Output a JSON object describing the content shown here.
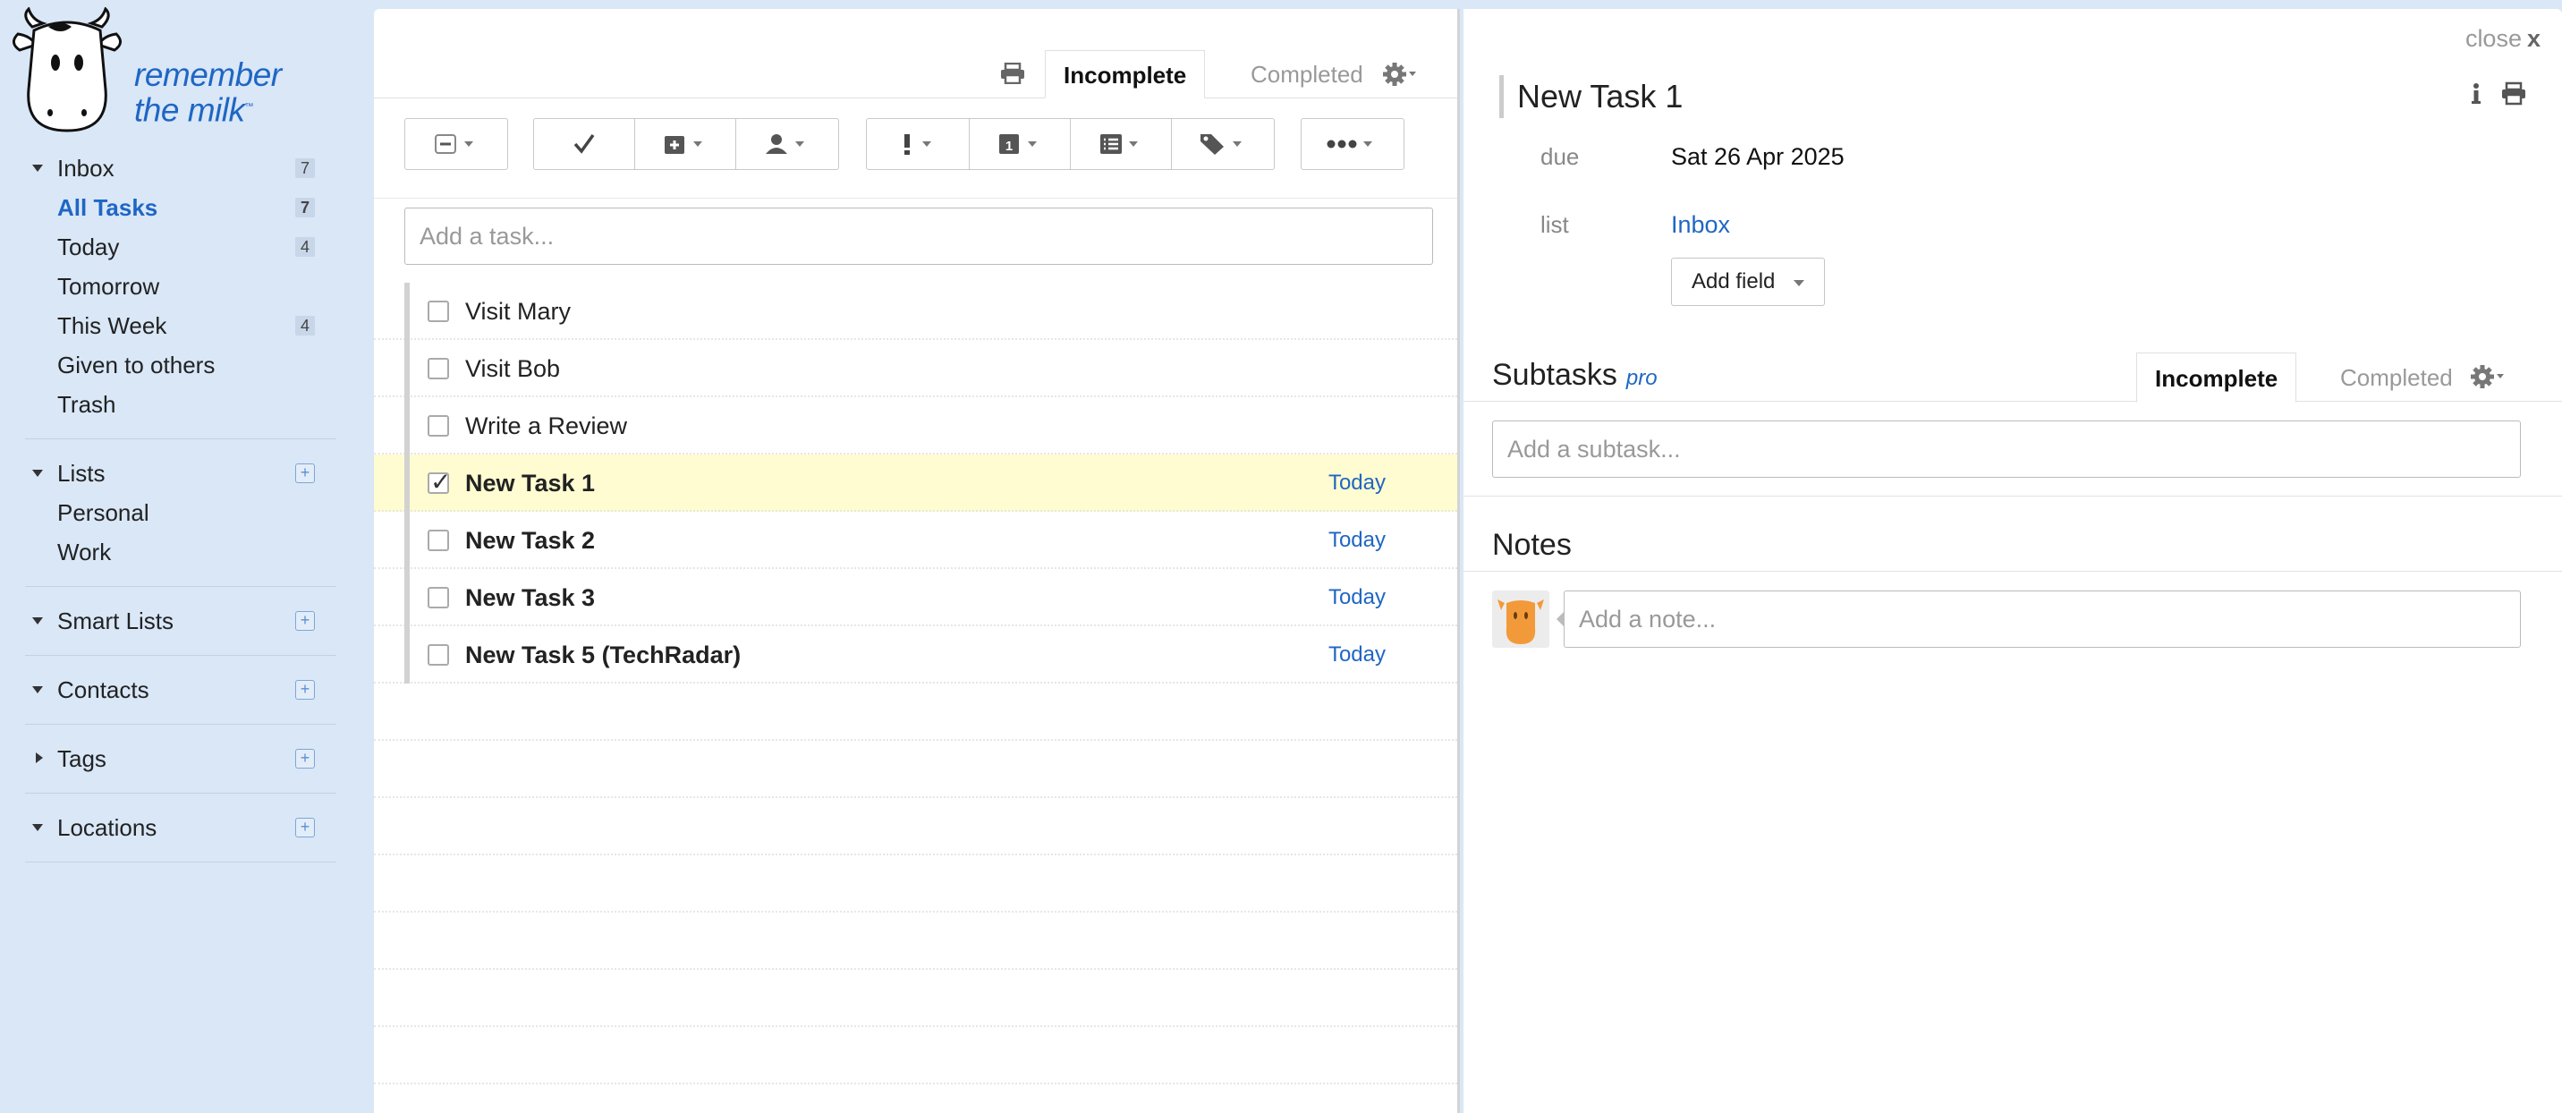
{
  "brand": {
    "name_line1": "remember",
    "name_line2": "the milk",
    "trademark": "™"
  },
  "sidebar": {
    "inbox": {
      "label": "Inbox",
      "count": "7",
      "items": [
        {
          "label": "All Tasks",
          "count": "7",
          "active": true
        },
        {
          "label": "Today",
          "count": "4"
        },
        {
          "label": "Tomorrow",
          "count": ""
        },
        {
          "label": "This Week",
          "count": "4"
        },
        {
          "label": "Given to others",
          "count": ""
        },
        {
          "label": "Trash",
          "count": ""
        }
      ]
    },
    "lists": {
      "label": "Lists",
      "items": [
        {
          "label": "Personal"
        },
        {
          "label": "Work"
        }
      ]
    },
    "smart_lists": {
      "label": "Smart Lists"
    },
    "contacts": {
      "label": "Contacts"
    },
    "tags": {
      "label": "Tags"
    },
    "locations": {
      "label": "Locations"
    },
    "add_symbol": "+"
  },
  "task_list": {
    "tabs": {
      "incomplete": "Incomplete",
      "completed": "Completed"
    },
    "add_placeholder": "Add a task...",
    "tasks": [
      {
        "title": "Visit Mary",
        "due": "",
        "bold": false,
        "checked": false,
        "selected": false
      },
      {
        "title": "Visit Bob",
        "due": "",
        "bold": false,
        "checked": false,
        "selected": false
      },
      {
        "title": "Write a Review",
        "due": "",
        "bold": false,
        "checked": false,
        "selected": false
      },
      {
        "title": "New Task 1",
        "due": "Today",
        "bold": true,
        "checked": true,
        "selected": true
      },
      {
        "title": "New Task 2",
        "due": "Today",
        "bold": true,
        "checked": false,
        "selected": false
      },
      {
        "title": "New Task 3",
        "due": "Today",
        "bold": true,
        "checked": false,
        "selected": false
      },
      {
        "title": "New Task 5 (TechRadar)",
        "due": "Today",
        "bold": true,
        "checked": false,
        "selected": false
      }
    ]
  },
  "detail": {
    "close_label": "close",
    "close_x": "x",
    "title": "New Task 1",
    "due_label": "due",
    "due_value": "Sat 26 Apr 2025",
    "list_label": "list",
    "list_value": "Inbox",
    "add_field_label": "Add field",
    "subtasks_heading": "Subtasks",
    "pro_badge": "pro",
    "subtask_tabs": {
      "incomplete": "Incomplete",
      "completed": "Completed"
    },
    "subtask_placeholder": "Add a subtask...",
    "notes_heading": "Notes",
    "note_placeholder": "Add a note..."
  },
  "colors": {
    "accent": "#1f66c4",
    "sidebar_bg": "#d9e7f7",
    "selected_row": "#fefcd0",
    "avatar": "#f29a3a"
  }
}
